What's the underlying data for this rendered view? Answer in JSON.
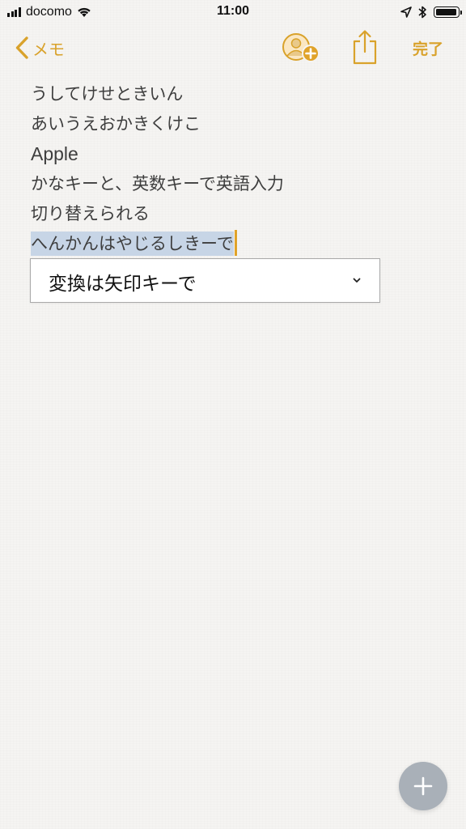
{
  "status_bar": {
    "carrier": "docomo",
    "time": "11:00",
    "signal_bars": 4,
    "battery_level": 0.95
  },
  "nav": {
    "back_label": "メモ",
    "done_label": "完了",
    "accent_color": "#d9a22b",
    "icons": [
      "chevron-left-icon",
      "add-person-icon",
      "share-icon"
    ]
  },
  "note": {
    "lines": [
      "うしてけせときいん",
      "あいうえおかきくけこ",
      "Apple",
      "かなキーと、英数キーで英語入力",
      "切り替えられる"
    ],
    "composing_text": "へんかんはやじるしきーで"
  },
  "conversion": {
    "candidate": "変換は矢印キーで",
    "highlight_color": "#c7d5e6"
  },
  "fab": {
    "icon": "plus-icon"
  }
}
